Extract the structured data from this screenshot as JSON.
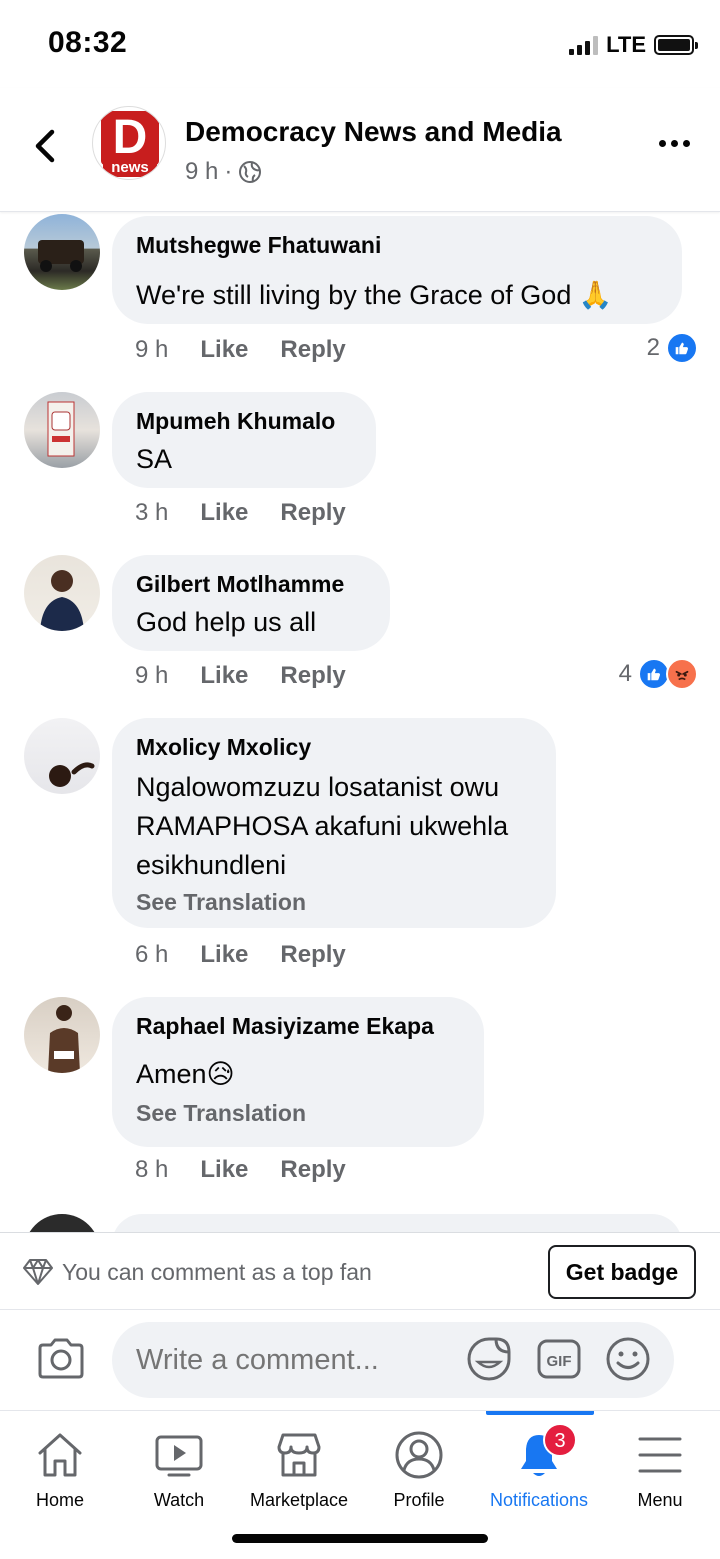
{
  "status_bar": {
    "time": "08:32",
    "network": "LTE"
  },
  "header": {
    "page_name": "Democracy News and Media",
    "time_ago": "9 h",
    "separator": "·",
    "logo_letter": "D",
    "logo_text": "news"
  },
  "comments": [
    {
      "author": "Mutshegwe Fhatuwani",
      "text": "We're still living by the Grace of God 🙏",
      "time": "9 h",
      "like_label": "Like",
      "reply_label": "Reply",
      "reaction_count": "2",
      "reactions": [
        "like"
      ]
    },
    {
      "author": "Mpumeh Khumalo",
      "text": "SA",
      "time": "3 h",
      "like_label": "Like",
      "reply_label": "Reply"
    },
    {
      "author": "Gilbert Motlhamme",
      "text": "God help us all",
      "time": "9 h",
      "like_label": "Like",
      "reply_label": "Reply",
      "reaction_count": "4",
      "reactions": [
        "like",
        "angry"
      ]
    },
    {
      "author": "Mxolicy Mxolicy",
      "text_lines": [
        "Ngalowomzuzu losatanist owu",
        "RAMAPHOSA akafuni ukwehla",
        "esikhundleni"
      ],
      "see_translation": "See Translation",
      "time": "6 h",
      "like_label": "Like",
      "reply_label": "Reply"
    },
    {
      "author": "Raphael Masiyizame Ekapa",
      "text": "Amen😥",
      "see_translation": "See Translation",
      "time": "8 h",
      "like_label": "Like",
      "reply_label": "Reply"
    }
  ],
  "top_fan": {
    "text": "You can comment as a top fan",
    "button": "Get badge"
  },
  "composer": {
    "placeholder": "Write a comment..."
  },
  "nav": {
    "items": [
      {
        "label": "Home",
        "icon": "home-icon"
      },
      {
        "label": "Watch",
        "icon": "watch-icon"
      },
      {
        "label": "Marketplace",
        "icon": "marketplace-icon"
      },
      {
        "label": "Profile",
        "icon": "profile-icon"
      },
      {
        "label": "Notifications",
        "icon": "bell-icon",
        "badge": "3",
        "active": true
      },
      {
        "label": "Menu",
        "icon": "menu-icon"
      }
    ],
    "accent": "#1877f2"
  }
}
